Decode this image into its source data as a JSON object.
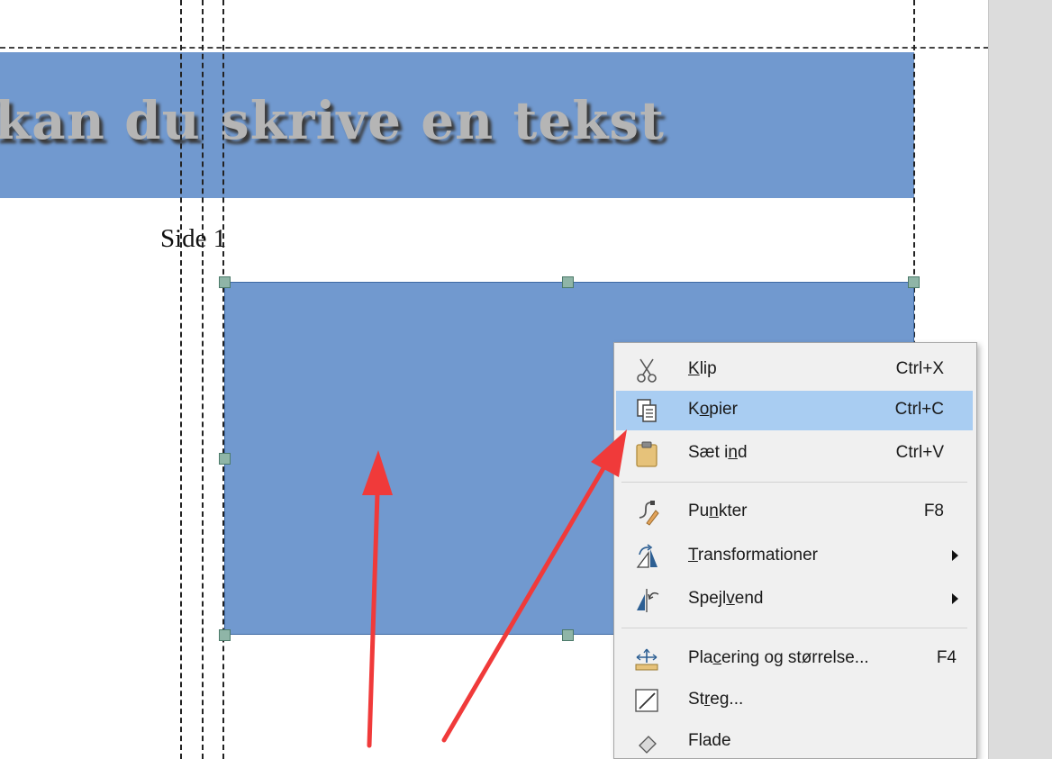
{
  "document": {
    "title_text": "kan du skrive en tekst",
    "page_label": "Side 1"
  },
  "context_menu": {
    "items": [
      {
        "icon": "scissors-icon",
        "pre": "",
        "key": "K",
        "post": "lip",
        "shortcut": "Ctrl+X"
      },
      {
        "icon": "copy-icon",
        "pre": "K",
        "key": "o",
        "post": "pier",
        "shortcut": "Ctrl+C"
      },
      {
        "icon": "clipboard-icon",
        "pre": "Sæt i",
        "key": "n",
        "post": "d",
        "shortcut": "Ctrl+V"
      },
      {
        "icon": "points-icon",
        "pre": "Pu",
        "key": "n",
        "post": "kter",
        "shortcut": "F8"
      },
      {
        "icon": "transformations-icon",
        "pre": "",
        "key": "T",
        "post": "ransformationer",
        "shortcut": ""
      },
      {
        "icon": "flip-icon",
        "pre": "Spejl",
        "key": "v",
        "post": "end",
        "shortcut": ""
      },
      {
        "icon": "position-size-icon",
        "pre": "Pla",
        "key": "c",
        "post": "ering og størrelse...",
        "shortcut": "F4"
      },
      {
        "icon": "line-icon",
        "pre": "St",
        "key": "r",
        "post": "eg...",
        "shortcut": ""
      },
      {
        "icon": "area-icon",
        "pre": "Flade",
        "key": "",
        "post": "",
        "shortcut": ""
      }
    ],
    "highlighted_item": "Kopier"
  },
  "colors": {
    "banner": "#7199cf",
    "shape_fill": "#7199cf",
    "menu_highlight": "#a9cdf2",
    "annotation_arrow": "#f03a3a"
  }
}
